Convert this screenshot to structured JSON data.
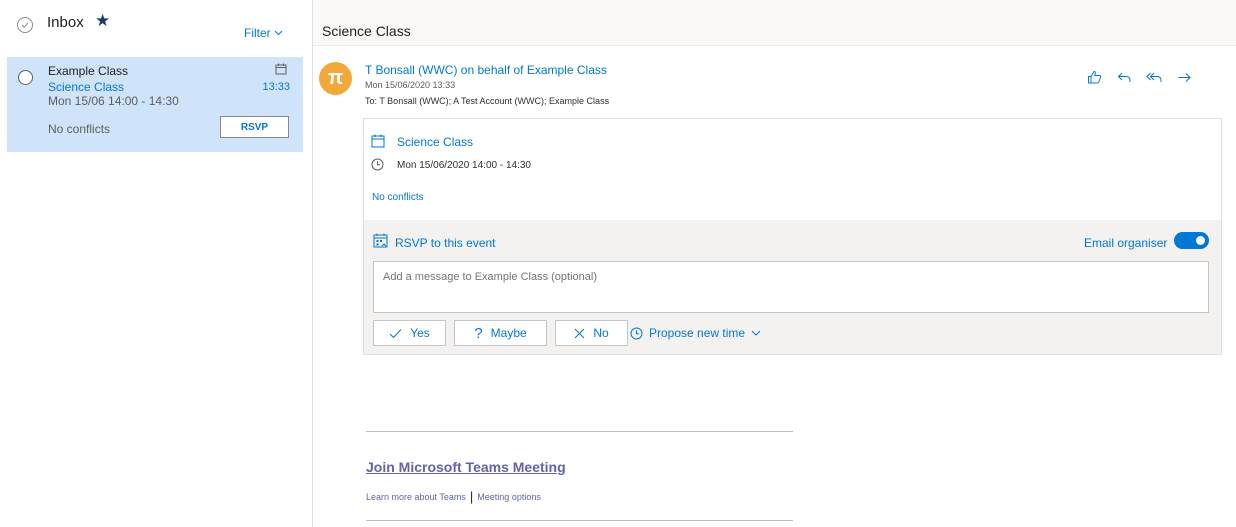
{
  "list": {
    "folder": "Inbox",
    "filter_label": "Filter",
    "message": {
      "sender": "Example Class",
      "subject": "Science Class",
      "when": "Mon 15/06 14:00 - 14:30",
      "time": "13:33",
      "conflicts": "No conflicts",
      "rsvp_label": "RSVP"
    }
  },
  "reading": {
    "title": "Science Class",
    "avatar_glyph": "π",
    "from": "T Bonsall (WWC) on behalf of Example Class",
    "sent": "Mon 15/06/2020 13:33",
    "to": "To:  T Bonsall (WWC); A Test Account (WWC); Example Class"
  },
  "card": {
    "title": "Science Class",
    "when": "Mon 15/06/2020 14:00 - 14:30",
    "conflicts": "No conflicts",
    "rsvp_label": "RSVP to this event",
    "email_organiser_label": "Email organiser",
    "email_organiser_on": true,
    "message_placeholder": "Add a message to Example Class (optional)",
    "yes_label": "Yes",
    "maybe_label": "Maybe",
    "no_label": "No",
    "propose_label": "Propose new time"
  },
  "teams": {
    "join_label": "Join Microsoft Teams Meeting",
    "learn_more": "Learn more about Teams",
    "separator": "|",
    "options": "Meeting options"
  },
  "colors": {
    "accent": "#0078d4",
    "selected_bg": "#cfe4fa",
    "avatar": "#f2a93b",
    "teams": "#6264a7"
  }
}
